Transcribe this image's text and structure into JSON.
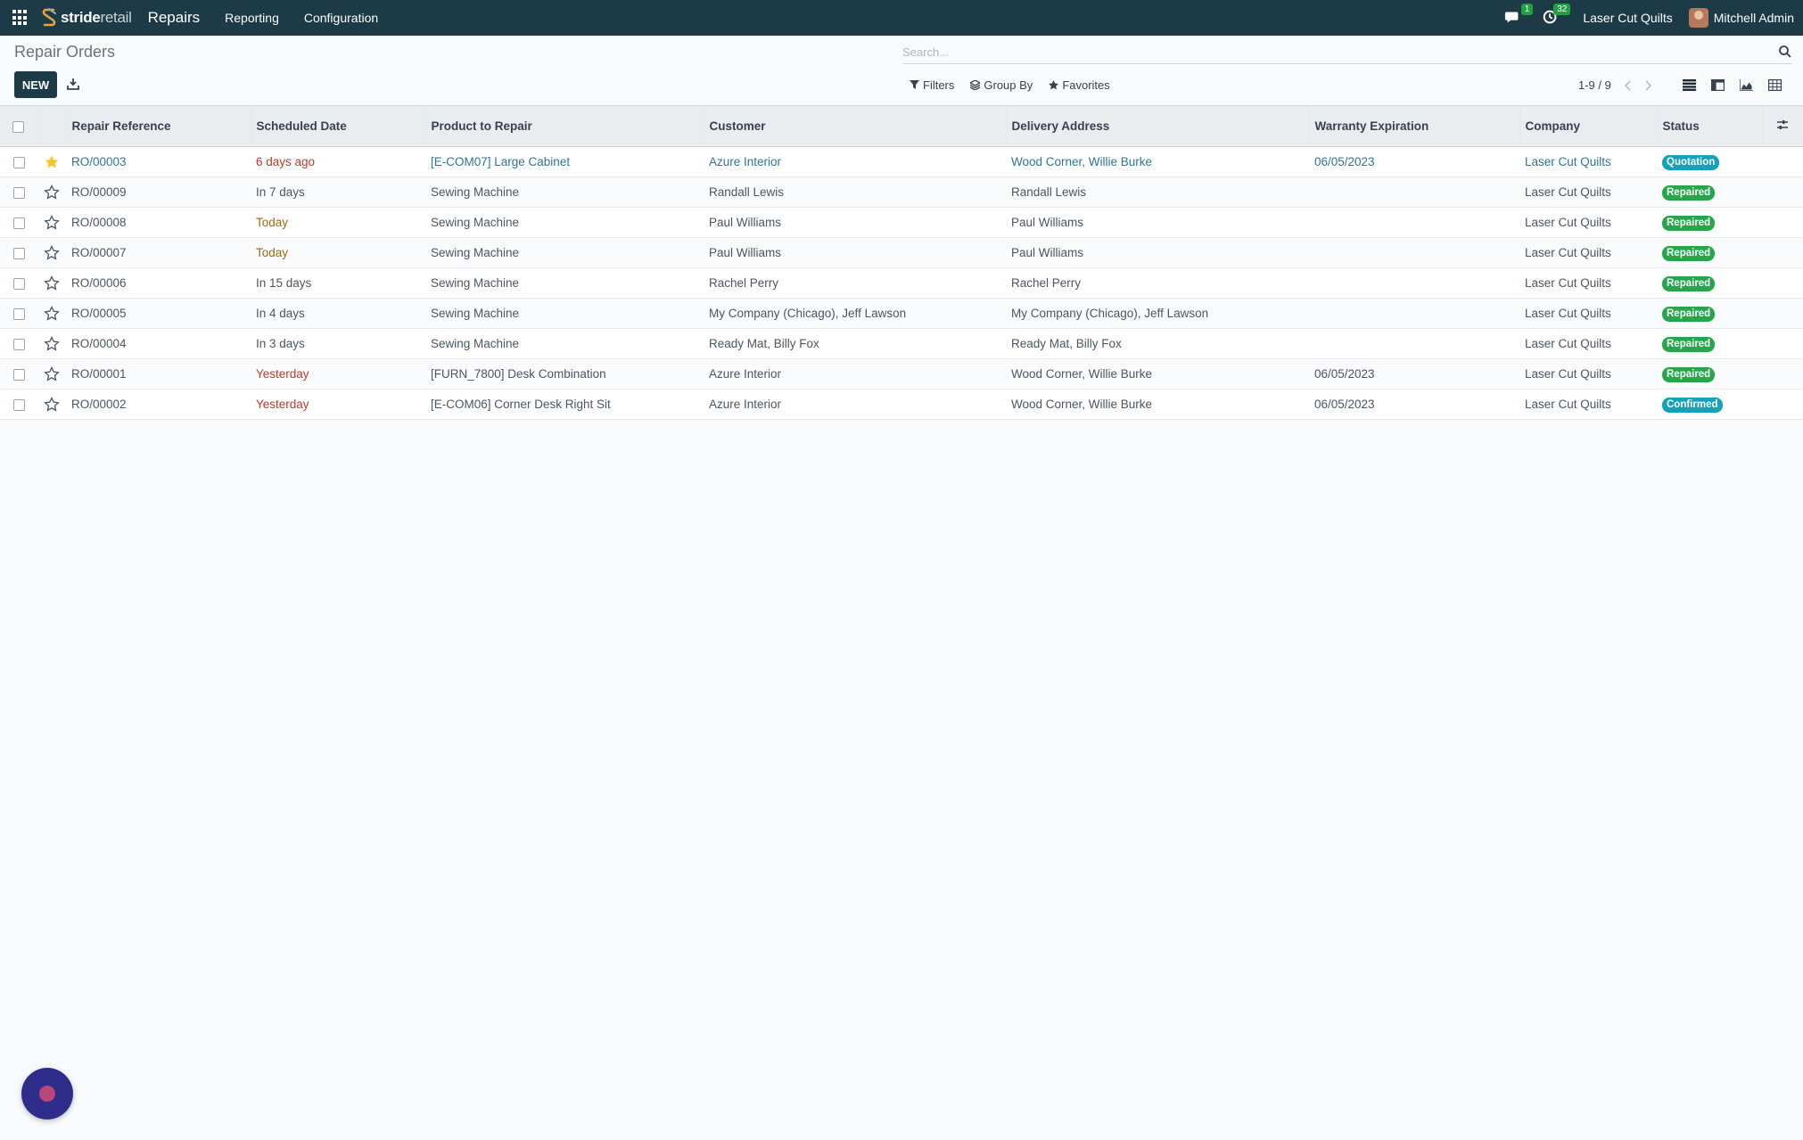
{
  "topbar": {
    "brand_bold": "stride",
    "brand_light": "retail",
    "app_name": "Repairs",
    "menu": [
      "Reporting",
      "Configuration"
    ],
    "messages_count": "1",
    "activities_count": "32",
    "company": "Laser Cut Quilts",
    "user": "Mitchell Admin"
  },
  "control_panel": {
    "title": "Repair Orders",
    "new_label": "NEW",
    "search_placeholder": "Search...",
    "filters_label": "Filters",
    "group_by_label": "Group By",
    "favorites_label": "Favorites",
    "pager": "1-9 / 9"
  },
  "table": {
    "columns": [
      "Repair Reference",
      "Scheduled Date",
      "Product to Repair",
      "Customer",
      "Delivery Address",
      "Warranty Expiration",
      "Company",
      "Status"
    ],
    "rows": [
      {
        "starred": true,
        "ref": "RO/00003",
        "date": "6 days ago",
        "date_style": "red",
        "product": "[E-COM07] Large Cabinet",
        "customer": "Azure Interior",
        "delivery": "Wood Corner, Willie Burke",
        "warranty": "06/05/2023",
        "company": "Laser Cut Quilts",
        "status": "Quotation",
        "status_style": "info",
        "linked": true
      },
      {
        "starred": false,
        "ref": "RO/00009",
        "date": "In 7 days",
        "date_style": "",
        "product": "Sewing Machine",
        "customer": "Randall Lewis",
        "delivery": "Randall Lewis",
        "warranty": "",
        "company": "Laser Cut Quilts",
        "status": "Repaired",
        "status_style": "success",
        "linked": false
      },
      {
        "starred": false,
        "ref": "RO/00008",
        "date": "Today",
        "date_style": "warn",
        "product": "Sewing Machine",
        "customer": "Paul Williams",
        "delivery": "Paul Williams",
        "warranty": "",
        "company": "Laser Cut Quilts",
        "status": "Repaired",
        "status_style": "success",
        "linked": false
      },
      {
        "starred": false,
        "ref": "RO/00007",
        "date": "Today",
        "date_style": "warn",
        "product": "Sewing Machine",
        "customer": "Paul Williams",
        "delivery": "Paul Williams",
        "warranty": "",
        "company": "Laser Cut Quilts",
        "status": "Repaired",
        "status_style": "success",
        "linked": false
      },
      {
        "starred": false,
        "ref": "RO/00006",
        "date": "In 15 days",
        "date_style": "",
        "product": "Sewing Machine",
        "customer": "Rachel Perry",
        "delivery": "Rachel Perry",
        "warranty": "",
        "company": "Laser Cut Quilts",
        "status": "Repaired",
        "status_style": "success",
        "linked": false
      },
      {
        "starred": false,
        "ref": "RO/00005",
        "date": "In 4 days",
        "date_style": "",
        "product": "Sewing Machine",
        "customer": "My Company (Chicago), Jeff Lawson",
        "delivery": "My Company (Chicago), Jeff Lawson",
        "warranty": "",
        "company": "Laser Cut Quilts",
        "status": "Repaired",
        "status_style": "success",
        "linked": false
      },
      {
        "starred": false,
        "ref": "RO/00004",
        "date": "In 3 days",
        "date_style": "",
        "product": "Sewing Machine",
        "customer": "Ready Mat, Billy Fox",
        "delivery": "Ready Mat, Billy Fox",
        "warranty": "",
        "company": "Laser Cut Quilts",
        "status": "Repaired",
        "status_style": "success",
        "linked": false
      },
      {
        "starred": false,
        "ref": "RO/00001",
        "date": "Yesterday",
        "date_style": "red",
        "product": "[FURN_7800] Desk Combination",
        "customer": "Azure Interior",
        "delivery": "Wood Corner, Willie Burke",
        "warranty": "06/05/2023",
        "company": "Laser Cut Quilts",
        "status": "Repaired",
        "status_style": "success",
        "linked": false
      },
      {
        "starred": false,
        "ref": "RO/00002",
        "date": "Yesterday",
        "date_style": "red",
        "product": "[E-COM06] Corner Desk Right Sit",
        "customer": "Azure Interior",
        "delivery": "Wood Corner, Willie Burke",
        "warranty": "06/05/2023",
        "company": "Laser Cut Quilts",
        "status": "Confirmed",
        "status_style": "info",
        "linked": false
      }
    ]
  },
  "colors": {
    "topbar": "#1c3b47",
    "link": "#2f7594",
    "danger": "#c0392b",
    "warning": "#9b6a12",
    "badge_info": "#15a0bb",
    "badge_success": "#26a64a",
    "star_active": "#f3c623"
  }
}
